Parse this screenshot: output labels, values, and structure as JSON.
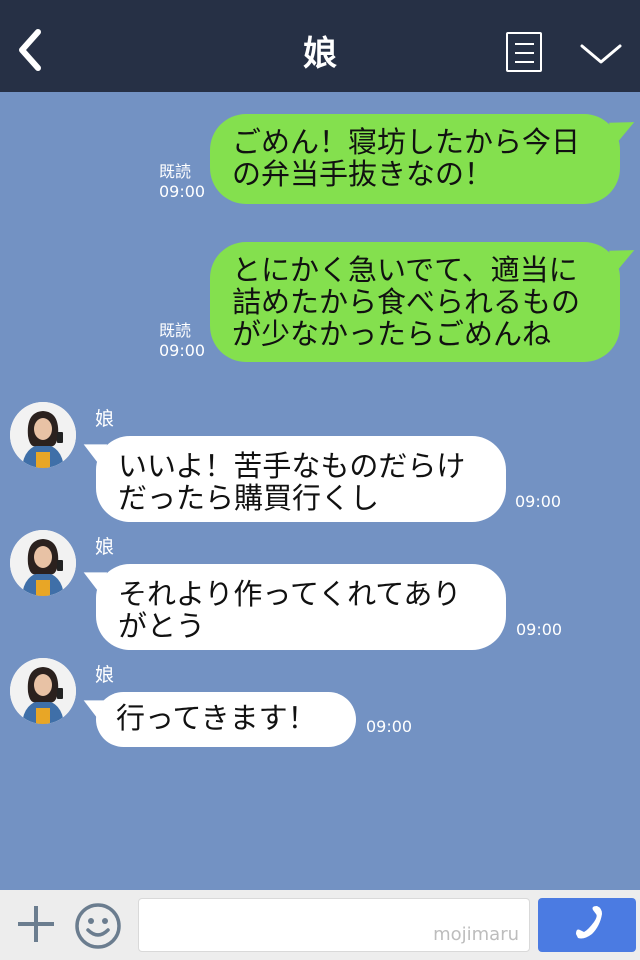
{
  "header": {
    "title": "娘",
    "back_icon": "back-chevron-icon",
    "menu_icon": "menu-list-icon",
    "collapse_icon": "chevron-down-icon"
  },
  "messages": [
    {
      "side": "outgoing",
      "lines": [
        "ごめん！寝坊したから今日",
        "の弁当手抜きなの！"
      ],
      "read": "既読",
      "time": "09:00"
    },
    {
      "side": "outgoing",
      "lines": [
        "とにかく急いでて、適当に",
        "詰めたから食べられるもの",
        "が少なかったらごめんね"
      ],
      "read": "既読",
      "time": "09:00"
    },
    {
      "side": "incoming",
      "name": "娘",
      "lines": [
        "いいよ！苦手なものだらけ",
        "だったら購買行くし"
      ],
      "time": "09:00"
    },
    {
      "side": "incoming",
      "name": "娘",
      "lines": [
        "それより作ってくれてあり",
        "がとう"
      ],
      "time": "09:00"
    },
    {
      "side": "incoming",
      "name": "娘",
      "lines": [
        "行ってきます！"
      ],
      "time": "09:00"
    }
  ],
  "footer": {
    "plus_icon": "plus-icon",
    "emoji_icon": "smiley-icon",
    "watermark": "mojimaru",
    "call_icon": "phone-icon"
  },
  "colors": {
    "header_bg": "#263045",
    "chat_bg": "#7392c3",
    "outgoing_bubble": "#84e04e",
    "incoming_bubble": "#ffffff",
    "call_button": "#4b7be2"
  }
}
